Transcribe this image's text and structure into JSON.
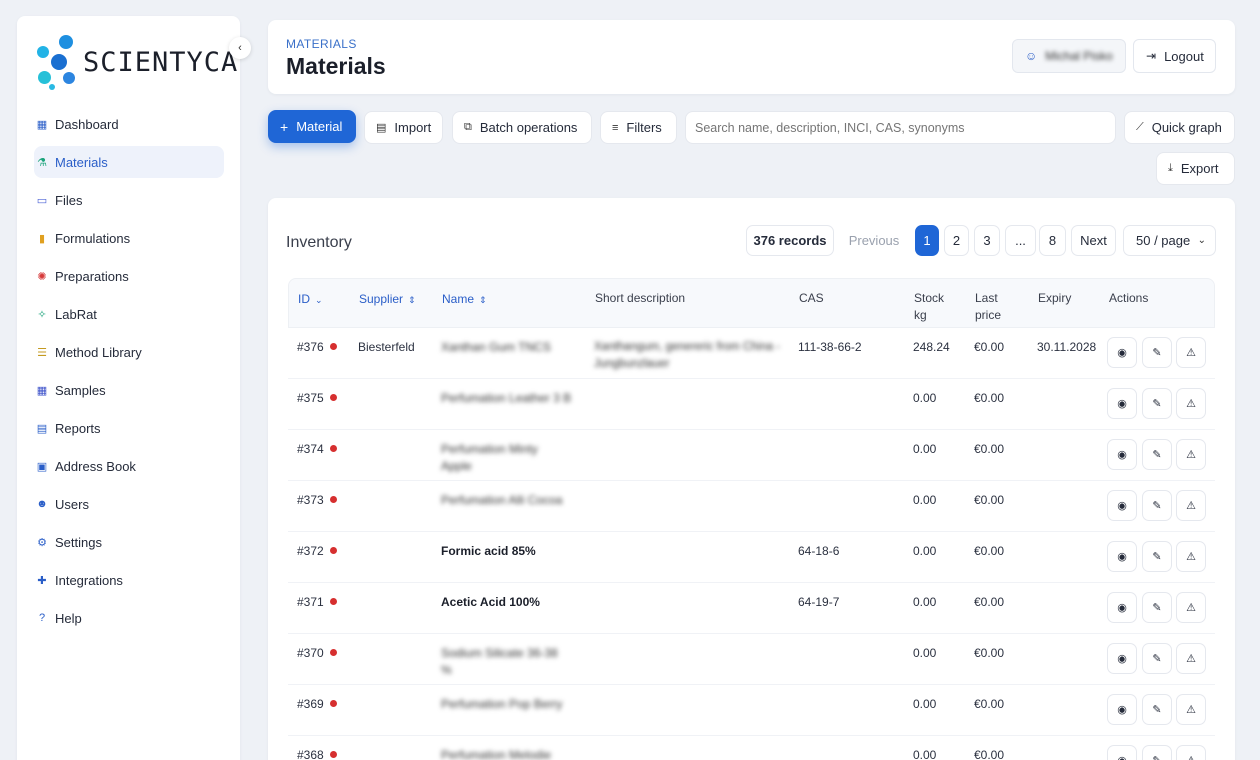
{
  "brand": {
    "name": "SCIENTYCA"
  },
  "sidebar": {
    "items": [
      {
        "label": "Dashboard",
        "icon": "dashboard-icon",
        "active": false
      },
      {
        "label": "Materials",
        "icon": "flask-icon",
        "active": true
      },
      {
        "label": "Files",
        "icon": "folder-icon",
        "active": false
      },
      {
        "label": "Formulations",
        "icon": "test-tube-icon",
        "active": false
      },
      {
        "label": "Preparations",
        "icon": "virus-icon",
        "active": false
      },
      {
        "label": "LabRat",
        "icon": "sparkle-icon",
        "active": false
      },
      {
        "label": "Method Library",
        "icon": "list-icon",
        "active": false
      },
      {
        "label": "Samples",
        "icon": "grid-icon",
        "active": false
      },
      {
        "label": "Reports",
        "icon": "report-icon",
        "active": false
      },
      {
        "label": "Address Book",
        "icon": "book-icon",
        "active": false
      },
      {
        "label": "Users",
        "icon": "users-icon",
        "active": false
      },
      {
        "label": "Settings",
        "icon": "gear-icon",
        "active": false
      },
      {
        "label": "Integrations",
        "icon": "puzzle-icon",
        "active": false
      },
      {
        "label": "Help",
        "icon": "help-icon",
        "active": false
      }
    ]
  },
  "header": {
    "breadcrumb": "MATERIALS",
    "title": "Materials",
    "user_name": "Michal Pisko",
    "logout_label": "Logout"
  },
  "toolbar": {
    "add_label": "Material",
    "import_label": "Import",
    "batch_label": "Batch operations",
    "filters_label": "Filters",
    "search_placeholder": "Search name, description, INCI, CAS, synonyms",
    "quick_graph_label": "Quick graph",
    "export_label": "Export"
  },
  "inventory": {
    "title": "Inventory",
    "records": "376 records",
    "previous": "Previous",
    "pages": [
      "1",
      "2",
      "3",
      "...",
      "8"
    ],
    "next": "Next",
    "per_page": "50 / page"
  },
  "table": {
    "headers": {
      "id": "ID",
      "supplier": "Supplier",
      "name": "Name",
      "desc": "Short description",
      "cas": "CAS",
      "stock1": "Stock",
      "stock2": "kg",
      "price1": "Last",
      "price2": "price",
      "expiry": "Expiry",
      "actions": "Actions"
    },
    "rows": [
      {
        "id": "#376",
        "supplier": "Biesterfeld",
        "name": "Xanthan Gum TNCS",
        "desc1": "Xanthangum, genereric from China -",
        "desc2": "Jungbunzlauer",
        "cas": "111-38-66-2",
        "stock": "248.24",
        "price": "€0.00",
        "expiry": "30.11.2028"
      },
      {
        "id": "#375",
        "supplier": "",
        "name": "Perfumation Leather 3 B",
        "desc1": "",
        "desc2": "",
        "cas": "",
        "stock": "0.00",
        "price": "€0.00",
        "expiry": ""
      },
      {
        "id": "#374",
        "supplier": "",
        "name": "Perfumation Minty",
        "name2": "Apple",
        "desc1": "",
        "desc2": "",
        "cas": "",
        "stock": "0.00",
        "price": "€0.00",
        "expiry": ""
      },
      {
        "id": "#373",
        "supplier": "",
        "name": "Perfumation Alli Cocoa",
        "desc1": "",
        "desc2": "",
        "cas": "",
        "stock": "0.00",
        "price": "€0.00",
        "expiry": ""
      },
      {
        "id": "#372",
        "supplier": "",
        "name": "Formic acid 85%",
        "desc1": "",
        "desc2": "",
        "cas": "64-18-6",
        "stock": "0.00",
        "price": "€0.00",
        "expiry": ""
      },
      {
        "id": "#371",
        "supplier": "",
        "name": "Acetic Acid 100%",
        "desc1": "",
        "desc2": "",
        "cas": "64-19-7",
        "stock": "0.00",
        "price": "€0.00",
        "expiry": ""
      },
      {
        "id": "#370",
        "supplier": "",
        "name": "Sodium Silicate 36-38",
        "name2": "%",
        "desc1": "",
        "desc2": "",
        "cas": "",
        "stock": "0.00",
        "price": "€0.00",
        "expiry": ""
      },
      {
        "id": "#369",
        "supplier": "",
        "name": "Perfumation Pop Berry",
        "desc1": "",
        "desc2": "",
        "cas": "",
        "stock": "0.00",
        "price": "€0.00",
        "expiry": ""
      },
      {
        "id": "#368",
        "supplier": "",
        "name": "Perfumation Melodie",
        "desc1": "",
        "desc2": "",
        "cas": "",
        "stock": "0.00",
        "price": "€0.00",
        "expiry": ""
      }
    ]
  },
  "colors": {
    "accent": "#1f66d6",
    "status_dot": "#d62f2f"
  }
}
